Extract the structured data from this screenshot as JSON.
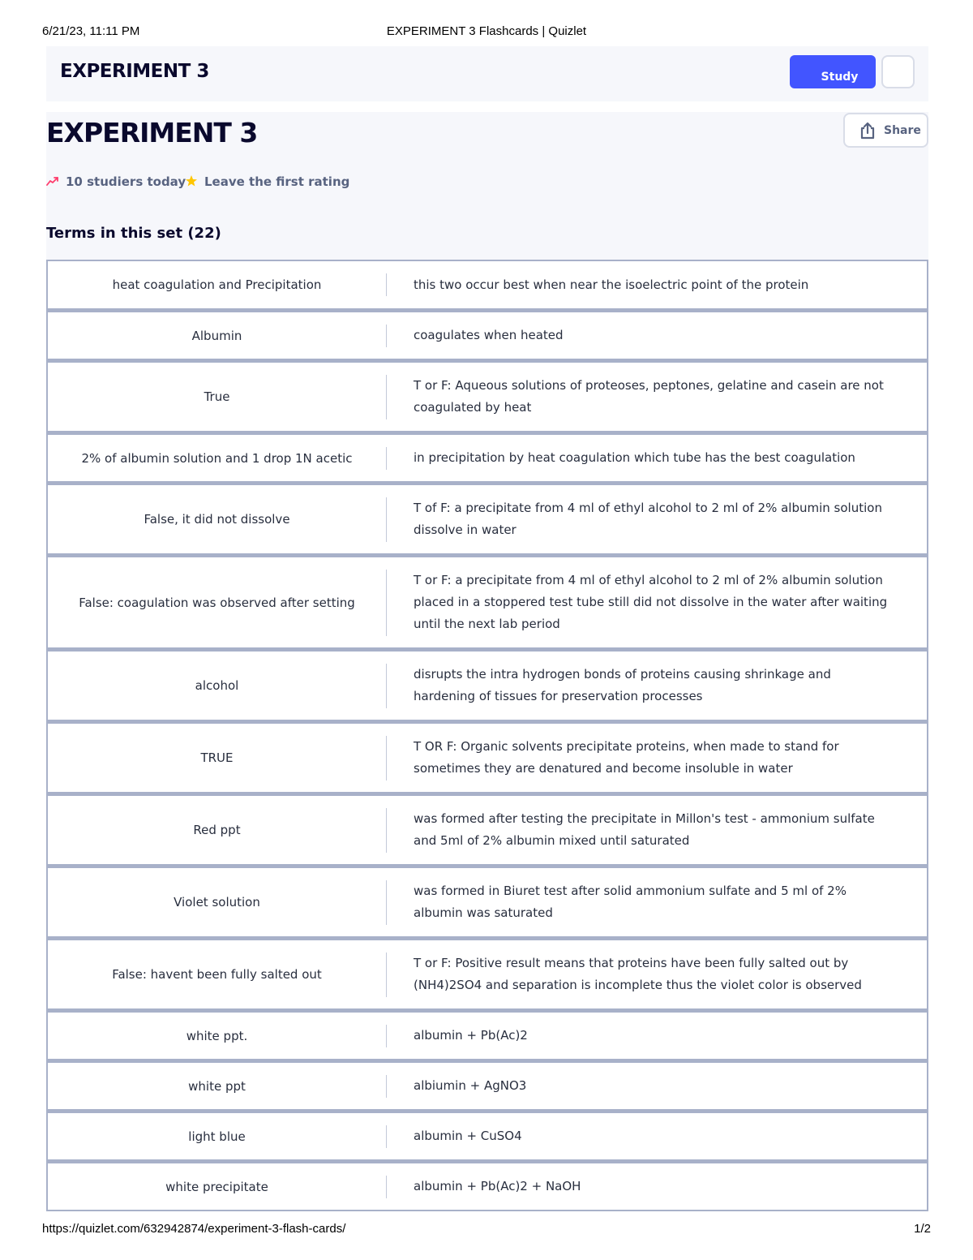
{
  "print_header": {
    "datetime": "6/21/23, 11:11 PM",
    "document_title": "EXPERIMENT 3 Flashcards | Quizlet"
  },
  "topbar": {
    "set_title": "EXPERIMENT 3",
    "study_label": "Study"
  },
  "main": {
    "title": "EXPERIMENT 3",
    "share_label": "Share",
    "studiers_text": "10 studiers today",
    "rating_text": "Leave the first rating",
    "terms_heading": "Terms in this set (22)"
  },
  "colors": {
    "accent": "#4255ff",
    "trend": "#ff3b6b",
    "star": "#ffc600",
    "panel_bg": "#f6f7fb"
  },
  "terms": [
    {
      "term": "heat coagulation and Precipitation",
      "definition": "this two occur best when near the isoelectric point of the protein"
    },
    {
      "term": "Albumin",
      "definition": "coagulates when heated"
    },
    {
      "term": "True",
      "definition": "T or F: Aqueous solutions of proteoses, peptones, gelatine and casein are not coagulated by heat"
    },
    {
      "term": "2% of albumin solution and 1 drop 1N acetic",
      "definition": "in precipitation by heat coagulation which tube has the best coagulation"
    },
    {
      "term": "False, it did not dissolve",
      "definition": "T of F: a precipitate from 4 ml of ethyl alcohol to 2 ml of 2% albumin solution dissolve in water"
    },
    {
      "term": "False: coagulation was observed after setting",
      "definition": "T or F: a precipitate from 4 ml of ethyl alcohol to 2 ml of 2% albumin solution placed in a stoppered test tube still did not dissolve in the water after waiting until the next lab period"
    },
    {
      "term": "alcohol",
      "definition": "disrupts the intra hydrogen bonds of proteins causing shrinkage and hardening of tissues for preservation processes"
    },
    {
      "term": "TRUE",
      "definition": "T OR F: Organic solvents precipitate proteins, when made to stand for sometimes they are denatured and become insoluble in water"
    },
    {
      "term": "Red ppt",
      "definition": "was formed after testing the precipitate in Millon's test - ammonium sulfate and 5ml of 2% albumin mixed until saturated"
    },
    {
      "term": "Violet solution",
      "definition": "was formed in Biuret test after solid ammonium sulfate and 5 ml of 2% albumin was saturated"
    },
    {
      "term": "False: havent been fully salted out",
      "definition": "T or F: Positive result means that proteins have been fully salted out by (NH4)2SO4 and separation is incomplete thus the violet color is observed"
    },
    {
      "term": "white ppt.",
      "definition": "albumin + Pb(Ac)2"
    },
    {
      "term": "white ppt",
      "definition": "albiumin + AgNO3"
    },
    {
      "term": "light blue",
      "definition": "albumin + CuSO4"
    },
    {
      "term": "white precipitate",
      "definition": "albumin + Pb(Ac)2 + NaOH"
    }
  ],
  "print_footer": {
    "url": "https://quizlet.com/632942874/experiment-3-flash-cards/",
    "page": "1/2"
  }
}
